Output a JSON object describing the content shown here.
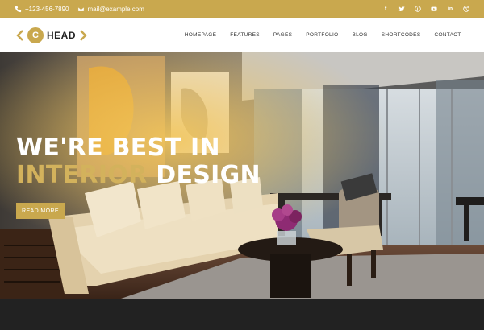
{
  "topbar": {
    "phone": "+123-456-7890",
    "email": "mail@example.com",
    "socials": [
      "facebook-icon",
      "twitter-icon",
      "pinterest-icon",
      "youtube-icon",
      "linkedin-icon",
      "dribbble-icon"
    ]
  },
  "nav": {
    "logo_letter": "C",
    "logo_text": "HEAD",
    "items": [
      "HOMEPAGE",
      "FEATURES",
      "PAGES",
      "PORTFOLIO",
      "BLOG",
      "SHORTCODES",
      "CONTACT"
    ]
  },
  "hero": {
    "line1": "WE'RE BEST IN",
    "line2_accent": "INTERIOR",
    "line2_rest": "DESIGN",
    "cta_label": "READ MORE"
  },
  "colors": {
    "accent": "#c9a84e",
    "dark": "#222222"
  }
}
